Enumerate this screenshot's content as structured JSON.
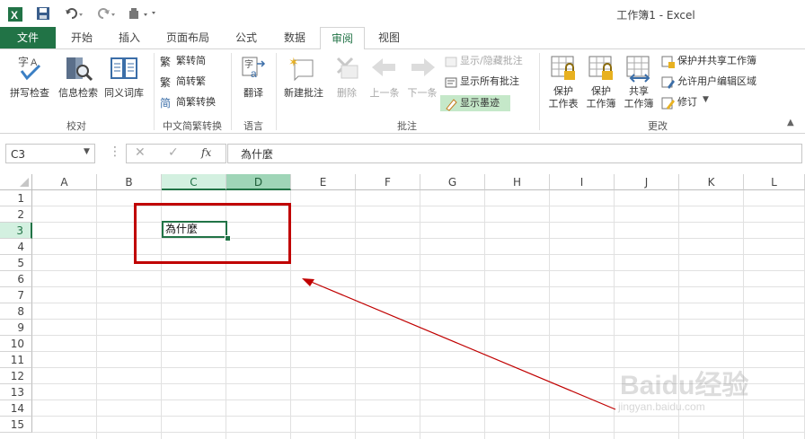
{
  "titlebar": {
    "title": "工作簿1 - Excel"
  },
  "tabs": [
    {
      "label": "文件"
    },
    {
      "label": "开始"
    },
    {
      "label": "插入"
    },
    {
      "label": "页面布局"
    },
    {
      "label": "公式"
    },
    {
      "label": "数据"
    },
    {
      "label": "审阅"
    },
    {
      "label": "视图"
    }
  ],
  "ribbon": {
    "proofing": {
      "spell": "拼写检查",
      "research": "信息检索",
      "thesaurus": "同义词库",
      "group": "校对"
    },
    "chinese": {
      "to_trad": "繁转简",
      "to_simp": "简转繁",
      "convert": "简繁转换",
      "group": "中文简繁转换"
    },
    "language": {
      "translate": "翻译",
      "group": "语言"
    },
    "comments": {
      "new": "新建批注",
      "delete": "删除",
      "prev": "上一条",
      "next": "下一条",
      "show_hide": "显示/隐藏批注",
      "show_all": "显示所有批注",
      "show_ink": "显示墨迹",
      "group": "批注"
    },
    "changes": {
      "protect_sheet_1": "保护",
      "protect_sheet_2": "工作表",
      "protect_book_1": "保护",
      "protect_book_2": "工作簿",
      "share_book_1": "共享",
      "share_book_2": "工作簿",
      "protect_share": "保护并共享工作簿",
      "allow_edit": "允许用户编辑区域",
      "track": "修订",
      "group": "更改"
    }
  },
  "formula_bar": {
    "name_box": "C3",
    "fx": "fx",
    "value": "為什麼"
  },
  "columns": [
    "A",
    "B",
    "C",
    "D",
    "E",
    "F",
    "G",
    "H",
    "I",
    "J",
    "K",
    "L"
  ],
  "rows": [
    "1",
    "2",
    "3",
    "4",
    "5",
    "6",
    "7",
    "8",
    "9",
    "10",
    "11",
    "12",
    "13",
    "14",
    "15"
  ],
  "cells": {
    "C3": "為什麼"
  },
  "watermark": {
    "brand": "Baidu经验",
    "url": "jingyan.baidu.com"
  },
  "colors": {
    "excel_green": "#217346",
    "annotation_red": "#c00000",
    "highlight": "#c5e8c9"
  }
}
